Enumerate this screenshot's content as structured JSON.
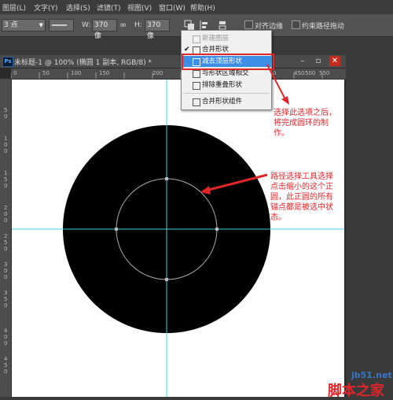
{
  "menubar": {
    "items": [
      "图层(L)",
      "文字(Y)",
      "选择(S)",
      "滤镜(T)",
      "视图(V)",
      "窗口(W)",
      "帮助(H)"
    ]
  },
  "options": {
    "stroke_size": "3 点",
    "w_label": "W:",
    "w_value": "370 像",
    "h_label": "H:",
    "h_value": "370 像",
    "align_edges": "对齐边缘",
    "constrain_path": "约束路径拖动"
  },
  "path_ops_menu": {
    "items": [
      {
        "label": "新建图层",
        "state": "disabled"
      },
      {
        "label": "合并形状",
        "state": "checked"
      },
      {
        "label": "减去顶层形状",
        "state": "highlighted"
      },
      {
        "label": "与形状区域相交",
        "state": "normal"
      },
      {
        "label": "排除重叠形状",
        "state": "normal"
      },
      {
        "label": "合并形状组件",
        "state": "normal"
      }
    ]
  },
  "document": {
    "title": "未标题-1 @ 100% (椭圆 1 副本, RGB/8) *",
    "app_badge": "Ps",
    "minimize": "–",
    "maximize": "▫",
    "close": "✕",
    "ruler_h_ticks": [
      "0",
      "50",
      "100",
      "150",
      "200",
      "250",
      "300",
      "350",
      "400",
      "450",
      "500",
      "550"
    ],
    "ruler_v_ticks": [
      "5\n0",
      "1\n0\n0",
      "1\n5\n0",
      "2\n0\n0",
      "2\n5\n0",
      "3\n0\n0",
      "3\n5\n0",
      "4\n0\n0",
      "4\n5\n0"
    ]
  },
  "annotations": {
    "note1": "选择此选项之后，\n将完成圆环的制\n作。",
    "note2": "路径选择工具选择\n点击缩小的这个正\n圆，此正圆的所有\n锚点都是被选中状\n态。"
  },
  "watermark": {
    "site": "jb51.net",
    "name": "脚本之家"
  },
  "colors": {
    "annotation": "#e0262b",
    "highlight": "#3d8ee6",
    "guide": "#3fd0d8",
    "shape": "#000000"
  }
}
